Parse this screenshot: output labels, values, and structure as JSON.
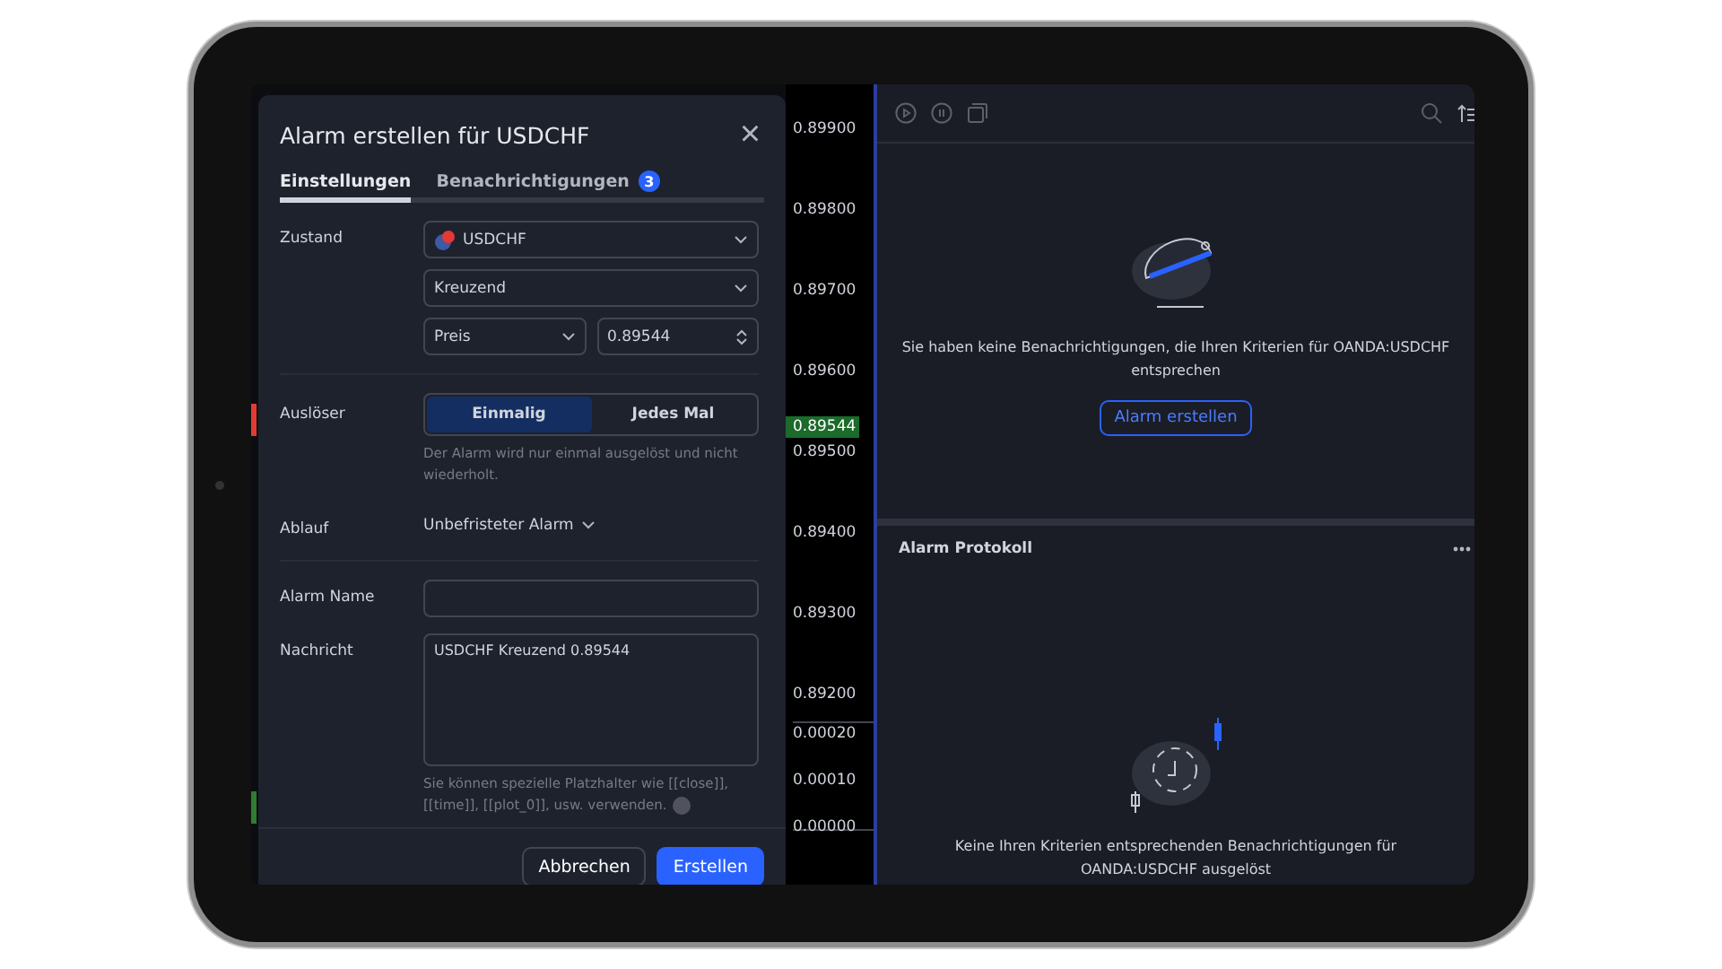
{
  "price_axis": {
    "ticks": [
      {
        "label": "0.89900",
        "kind": "tick"
      },
      {
        "label": "0.89800",
        "kind": "tick"
      },
      {
        "label": "0.89700",
        "kind": "tick"
      },
      {
        "label": "0.89600",
        "kind": "tick"
      },
      {
        "label": "0.89544",
        "kind": "current"
      },
      {
        "label": "0.89500",
        "kind": "tick"
      },
      {
        "label": "0.89400",
        "kind": "tick"
      },
      {
        "label": "0.89300",
        "kind": "tick"
      },
      {
        "label": "0.89200",
        "kind": "tick"
      }
    ],
    "indicator_ticks": [
      "0.00020",
      "0.00010",
      "0.00000"
    ]
  },
  "dialog": {
    "title": "Alarm erstellen für USDCHF",
    "close": "×",
    "tabs": [
      {
        "label": "Einstellungen",
        "selected": true
      },
      {
        "label": "Benachrichtigungen",
        "selected": false,
        "badge": "3"
      }
    ],
    "condition": {
      "label": "Zustand",
      "symbol": "USDCHF",
      "operator": "Kreuzend",
      "source": "Preis",
      "value": "0.89544"
    },
    "trigger": {
      "label": "Auslöser",
      "options": [
        {
          "label": "Einmalig",
          "selected": true
        },
        {
          "label": "Jedes Mal",
          "selected": false
        }
      ],
      "hint": "Der Alarm wird nur einmal ausgelöst und nicht wiederholt."
    },
    "expiration": {
      "label": "Ablauf",
      "value": "Unbefristeter Alarm"
    },
    "name": {
      "label": "Alarm Name"
    },
    "message": {
      "label": "Nachricht",
      "value": "USDCHF Kreuzend 0.89544",
      "hint": "Sie können spezielle Platzhalter wie [[close]], [[time]], [[plot_0]], usw. verwenden."
    },
    "buttons": [
      {
        "label": "Abbrechen",
        "kind": "secondary"
      },
      {
        "label": "Erstellen",
        "kind": "primary"
      }
    ]
  },
  "alerts_panel": {
    "empty_text": "Sie haben keine Benachrichtigungen, die Ihren Kriterien für OANDA:USDCHF entsprechen",
    "button": "Alarm erstellen"
  },
  "log_panel": {
    "title": "Alarm Protokoll",
    "empty_text": "Keine Ihren Kriterien entsprechenden Benachrichtigungen für OANDA:USDCHF ausgelöst"
  }
}
